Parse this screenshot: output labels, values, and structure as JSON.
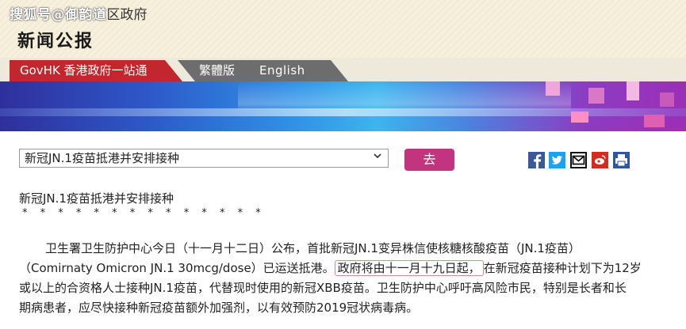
{
  "header": {
    "watermark": "搜狐号@御韵道",
    "org_suffix": "区政府",
    "section_title": "新闻公报"
  },
  "tabs": {
    "govhk": "GovHK 香港政府一站通",
    "traditional": "繁體版",
    "english": "English"
  },
  "selector": {
    "value": "新冠JN.1疫苗抵港并安排接种",
    "go_label": "去"
  },
  "share_icons": [
    "facebook-icon",
    "twitter-icon",
    "mail-icon",
    "weibo-icon",
    "print-icon"
  ],
  "article": {
    "title": "新冠JN.1疫苗抵港并安排接种",
    "stars": "* * * * * * * * * * * * * *",
    "line1": "卫生署卫生防护中心今日（十一月十二日）公布，首批新冠JN.1变异株信使核糖核酸疫苗（JN.1疫苗）",
    "line2_a": "（Comirnaty Omicron JN.1 30mcg/dose）已运送抵港。",
    "line2_highlight": "政府将由十一月十九日起，",
    "line2_b": "在新冠疫苗接种计划下为12岁",
    "line3": "或以上的合资格人士接种JN.1疫苗，代替现时使用的新冠XBB疫苗。卫生防护中心呼吁高风险市民，特别是长者和长",
    "line4": "期病患者，应尽快接种新冠疫苗额外加强剂，以有效预防2019冠状病毒病。"
  },
  "colors": {
    "govhk_tab": "#c2272d",
    "tab_gray": "#6d6d6d",
    "go_button": "#c3347f"
  }
}
